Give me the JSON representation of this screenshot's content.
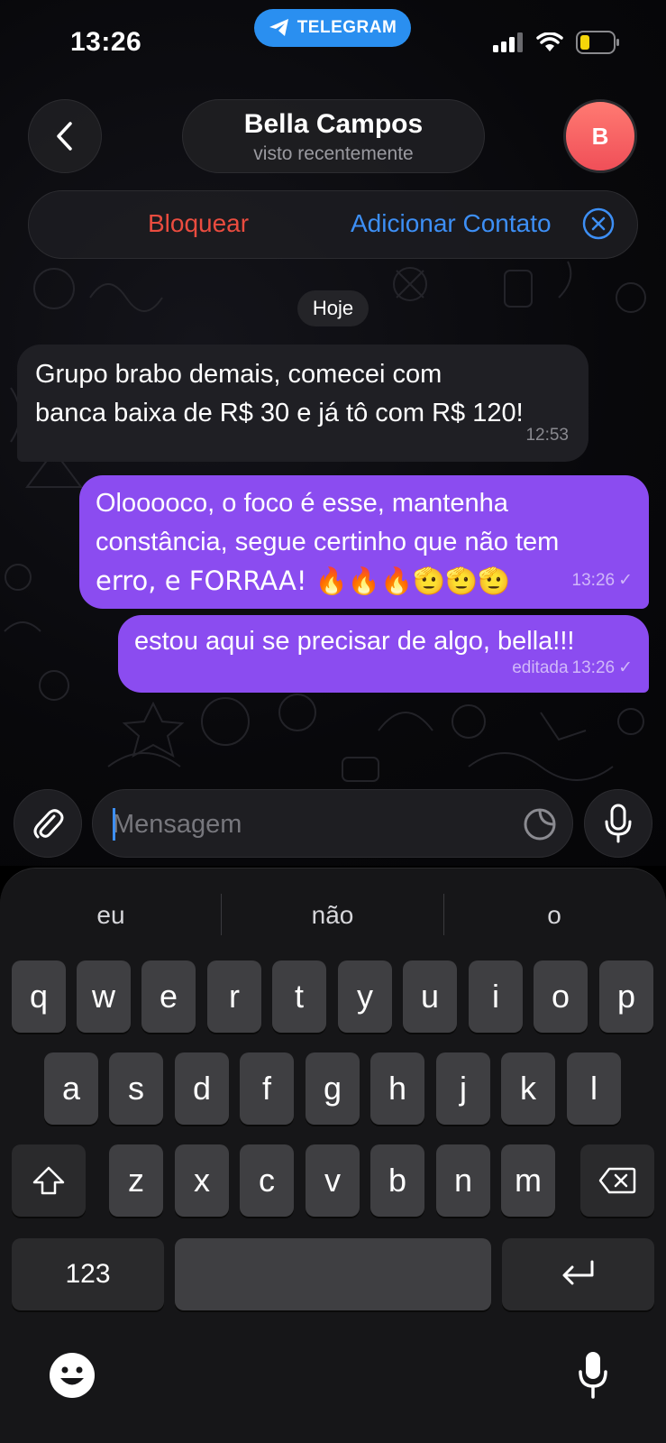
{
  "status_bar": {
    "time": "13:26",
    "app_pill": "TELEGRAM",
    "icons": [
      "signal-icon",
      "wifi-icon",
      "battery-low-icon"
    ]
  },
  "header": {
    "back_icon": "chevron-left-icon",
    "contact_name": "Bella Campos",
    "contact_status": "visto recentemente",
    "avatar_initial": "B",
    "avatar_color": "#f04f58"
  },
  "action_bar": {
    "block_label": "Bloquear",
    "add_contact_label": "Adicionar Contato",
    "block_color": "#ea4c3f",
    "add_color": "#3d8ff5"
  },
  "date_chip": "Hoje",
  "messages": [
    {
      "direction": "incoming",
      "lines": [
        "Grupo brabo demais, comecei com",
        "banca baixa de R$ 30 e já tô com R$ 120!"
      ],
      "time": "12:53"
    },
    {
      "direction": "outgoing",
      "lines": [
        "Olooooco, o foco é esse, mantenha",
        "constância, segue certinho que não tem",
        "erro, e FORRAA! 🔥🔥🔥🫡🫡🫡"
      ],
      "time": "13:26",
      "read_mark": "✓"
    },
    {
      "direction": "outgoing",
      "lines": [
        "estou aqui se precisar de algo,  bella!!!"
      ],
      "edited_label": "editada",
      "time": "13:26",
      "read_mark": "✓"
    }
  ],
  "bubble_colors": {
    "incoming": "#1f1f24",
    "outgoing": "#8b4cf0"
  },
  "composer": {
    "placeholder": "Mensagem",
    "value": "",
    "attach_icon": "paperclip-icon",
    "sticker_icon": "sticker-icon",
    "mic_icon": "microphone-icon"
  },
  "keyboard": {
    "suggestions": [
      "eu",
      "não",
      "o"
    ],
    "row1": [
      "q",
      "w",
      "e",
      "r",
      "t",
      "y",
      "u",
      "i",
      "o",
      "p"
    ],
    "row2": [
      "a",
      "s",
      "d",
      "f",
      "g",
      "h",
      "j",
      "k",
      "l"
    ],
    "row3": [
      "z",
      "x",
      "c",
      "v",
      "b",
      "n",
      "m"
    ],
    "numbers_key": "123",
    "icons": [
      "shift-icon",
      "backspace-icon",
      "return-icon",
      "emoji-icon",
      "dictation-mic-icon"
    ]
  }
}
